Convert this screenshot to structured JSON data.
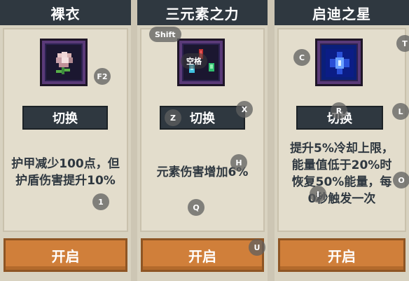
{
  "cards": [
    {
      "title": "裸衣",
      "switch_label": "切换",
      "description_lines": [
        "护甲减少100点，但",
        "护盾伤害提升10%"
      ],
      "open_label": "开启",
      "icon": "cloak-flower-icon"
    },
    {
      "title": "三元素之力",
      "switch_label": "切换",
      "description_lines": [
        "元素伤害增加6%"
      ],
      "open_label": "开启",
      "icon": "three-elements-crystal-icon",
      "icon_overlay_text": "空格"
    },
    {
      "title": "启迪之星",
      "switch_label": "切换",
      "description_lines": [
        "提升5%冷却上限，",
        "能量值低于20%时",
        "恢复50%能量，每",
        "0秒触发一次"
      ],
      "open_label": "开启",
      "icon": "blue-star-icon"
    }
  ],
  "key_hints": {
    "shift": "Shift",
    "f2": "F2",
    "c": "C",
    "t": "T",
    "z": "Z",
    "x": "X",
    "r": "R",
    "l": "L",
    "h": "H",
    "one": "1",
    "q": "Q",
    "i": "I",
    "o": "O",
    "u": "U"
  },
  "colors": {
    "header": "#2f3840",
    "open_button": "#d07f3a",
    "panel": "#e3ddcc"
  }
}
